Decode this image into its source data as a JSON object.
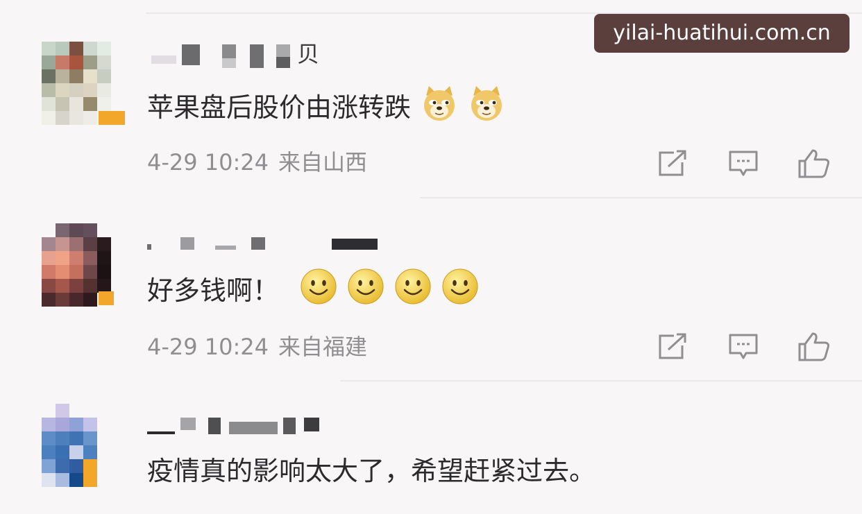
{
  "watermark": "yilai-huatihui.com.cn",
  "colors": {
    "background": "#f8f6f6",
    "text": "#2b2a2c",
    "meta": "#8f8e90",
    "badge": "#f3a72a",
    "icon": "#8f8e90"
  },
  "comments": [
    {
      "username_suffix": "贝",
      "username_censored": true,
      "text": "苹果盘后股价由涨转跌",
      "emojis": [
        "doge-emoji",
        "doge-emoji"
      ],
      "time": "4-29 10:24",
      "location": "来自山西",
      "actions": [
        "share-icon",
        "comment-icon",
        "like-icon"
      ]
    },
    {
      "username_suffix": "",
      "username_censored": true,
      "text": "好多钱啊！",
      "emojis": [
        "smile-emoji",
        "smile-emoji",
        "smile-emoji",
        "smile-emoji"
      ],
      "time": "4-29 10:24",
      "location": "来自福建",
      "actions": [
        "share-icon",
        "comment-icon",
        "like-icon"
      ]
    },
    {
      "username_suffix": "",
      "username_censored": true,
      "text": "疫情真的影响太大了，希望赶紧过去。",
      "emojis": [],
      "time": "",
      "location": "",
      "actions": []
    }
  ]
}
